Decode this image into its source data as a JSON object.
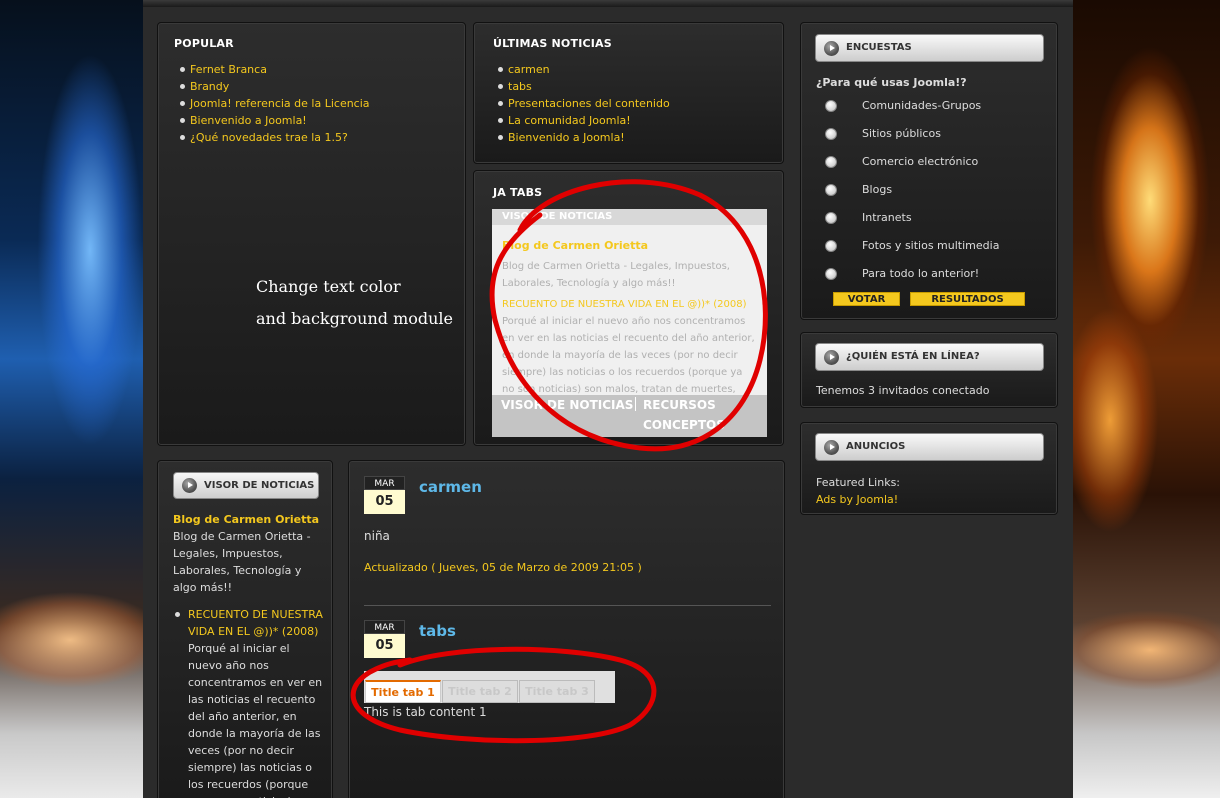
{
  "popular": {
    "title": "POPULAR",
    "items": [
      "Fernet Branca",
      "Brandy",
      "Joomla! referencia de la Licencia",
      "Bienvenido a Joomla!",
      "¿Qué novedades trae la 1.5?"
    ]
  },
  "annotation": {
    "line1": "Change text color",
    "line2": "and background module"
  },
  "ultimas": {
    "title": "ÚLTIMAS NOTICIAS",
    "items": [
      "carmen",
      "tabs",
      "Presentaciones del contenido",
      "La comunidad Joomla!",
      "Bienvenido a Joomla!"
    ]
  },
  "jatabs": {
    "title": "JA TABS",
    "inner_header": "VISOR DE NOTICIAS",
    "post1_title": "Blog de Carmen Orietta",
    "post1_text": "Blog de Carmen Orietta - Legales, Impuestos, Laborales, Tecnología y algo más!!",
    "post2_title": "RECUENTO DE NUESTRA VIDA EN EL @))* (2008)",
    "post2_text": "Porqué al iniciar el nuevo año nos concentramos en ver en las noticias el recuento del año anterior, en donde la mayoría de las veces (por no decir siempre) las noticias o los recuerdos (porque ya no son noticias) son malos, tratan de muertes, bombas, guerras, aumento de TODO",
    "tab1": "VISOR DE NOTICIAS",
    "tab2": "RECURSOS",
    "tab3": "CONCEPTOS"
  },
  "visor": {
    "title": "VISOR DE NOTICIAS",
    "blog_title": "Blog de Carmen Orietta",
    "blog_text": "Blog de Carmen Orietta - Legales, Impuestos, Laborales, Tecnología y algo más!!",
    "item_title": "RECUENTO DE NUESTRA VIDA EN EL @))* (2008)",
    "item_text": "Porqué al iniciar el nuevo año nos concentramos en ver en las noticias el recuento del año anterior, en donde la mayoría de las veces (por no decir siempre) las noticias o los recuerdos (porque ya no son noticias) son malos,"
  },
  "articles": [
    {
      "month": "MAR",
      "day": "05",
      "title": "carmen",
      "text": "niña",
      "updated": "Actualizado ( Jueves, 05 de Marzo de 2009 21:05 )"
    },
    {
      "month": "MAR",
      "day": "05",
      "title": "tabs"
    }
  ],
  "tabs_demo": {
    "tab1": "Title tab 1",
    "tab2": "Title tab 2",
    "tab3": "Title tab 3",
    "content": "This is tab content 1"
  },
  "encuestas": {
    "title": "ENCUESTAS",
    "question": "¿Para qué usas Joomla!?",
    "options": [
      "Comunidades-Grupos",
      "Sitios públicos",
      "Comercio electrónico",
      "Blogs",
      "Intranets",
      "Fotos y sitios multimedia",
      "Para todo lo anterior!"
    ],
    "vote": "VOTAR",
    "results": "RESULTADOS"
  },
  "quien": {
    "title": "¿QUIÉN ESTÁ EN LÍNEA?",
    "text": "Tenemos 3 invitados conectado"
  },
  "anuncios": {
    "title": "ANUNCIOS",
    "featured": "Featured Links:",
    "ads": "Ads by Joomla!"
  },
  "colors": {
    "accent_yellow": "#f4c81e",
    "title_blue": "#5eb8e8",
    "annotation_red": "#e00000",
    "tab_orange": "#e36a00"
  }
}
